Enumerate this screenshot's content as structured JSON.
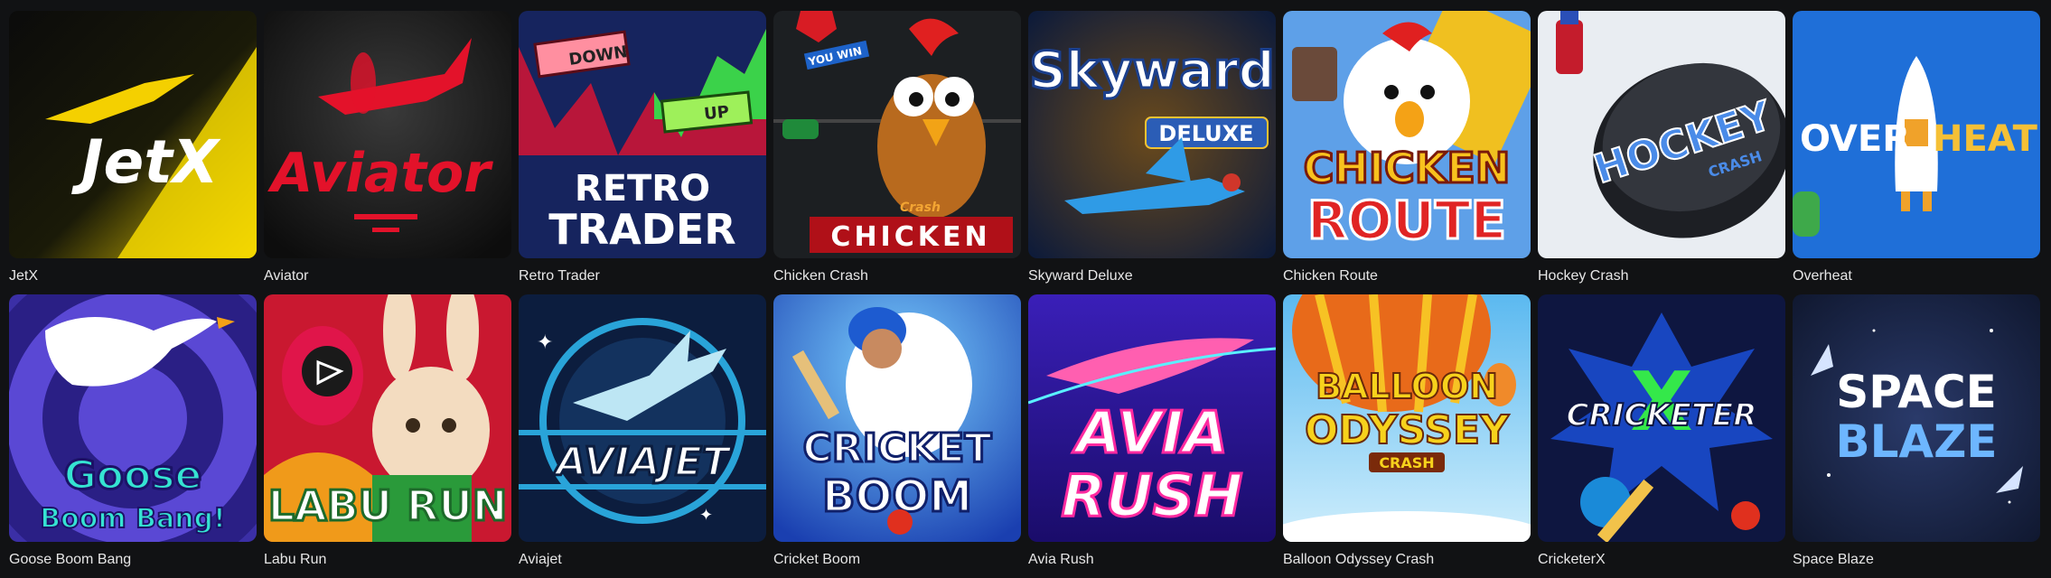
{
  "games": [
    {
      "id": "jetx",
      "name": "JetX",
      "art": {
        "line1": "JetX"
      }
    },
    {
      "id": "aviator",
      "name": "Aviator",
      "art": {
        "line1": "Aviator"
      }
    },
    {
      "id": "retro-trader",
      "name": "Retro Trader",
      "art": {
        "line1": "RETRO",
        "line2": "TRADER",
        "down": "DOWN",
        "up": "UP"
      }
    },
    {
      "id": "chicken-crash",
      "name": "Chicken Crash",
      "art": {
        "line1": "CHICKEN",
        "sign": "YOU WIN",
        "tag": "Crash"
      }
    },
    {
      "id": "skyward-deluxe",
      "name": "Skyward Deluxe",
      "art": {
        "line1": "Skyward",
        "line2": "DELUXE"
      }
    },
    {
      "id": "chicken-route",
      "name": "Chicken Route",
      "art": {
        "line1": "CHICKEN",
        "line2": "ROUTE"
      }
    },
    {
      "id": "hockey-crash",
      "name": "Hockey Crash",
      "art": {
        "line1": "HOCKEY",
        "line2": "CRASH"
      }
    },
    {
      "id": "overheat",
      "name": "Overheat",
      "art": {
        "line1": "OVER",
        "line2": "HEAT"
      }
    },
    {
      "id": "goose-boom-bang",
      "name": "Goose Boom Bang",
      "art": {
        "line1": "Goose",
        "line2": "Boom Bang!"
      }
    },
    {
      "id": "labu-run",
      "name": "Labu Run",
      "art": {
        "line1": "LABU RUN"
      }
    },
    {
      "id": "aviajet",
      "name": "Aviajet",
      "art": {
        "line1": "AVIAJET"
      }
    },
    {
      "id": "cricket-boom",
      "name": "Cricket Boom",
      "art": {
        "line1": "CRICKET",
        "line2": "BOOM"
      }
    },
    {
      "id": "avia-rush",
      "name": "Avia Rush",
      "art": {
        "line1": "AVIA",
        "line2": "RUSH"
      }
    },
    {
      "id": "balloon-odyssey-crash",
      "name": "Balloon Odyssey Crash",
      "art": {
        "line1": "BALLOON",
        "line2": "ODYSSEY",
        "line3": "CRASH"
      }
    },
    {
      "id": "cricketerx",
      "name": "CricketerX",
      "art": {
        "line1": "CRICKETER",
        "line2": "X"
      }
    },
    {
      "id": "space-blaze",
      "name": "Space Blaze",
      "art": {
        "line1": "SPACE",
        "line2": "BLAZE"
      }
    }
  ]
}
